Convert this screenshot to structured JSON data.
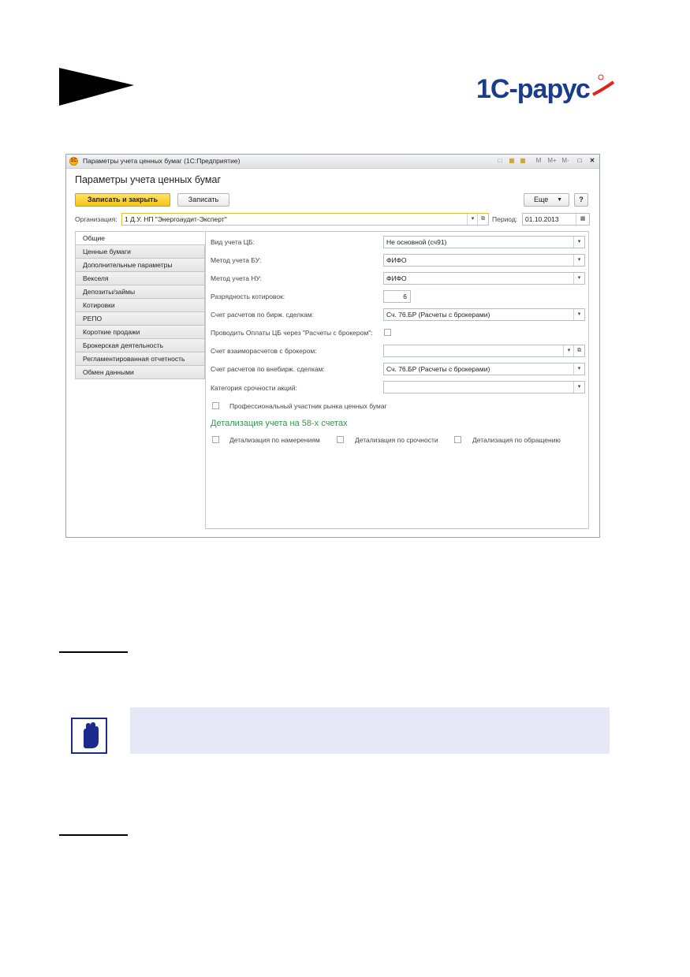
{
  "logo": {
    "text": "1С-рарус",
    "brand_color": "#1b3c8c",
    "accent_color": "#e2231a"
  },
  "window": {
    "title": "Параметры учета ценных бумаг  (1С:Предприятие)",
    "titlebar_buttons": [
      "М",
      "М+",
      "М-"
    ],
    "form_title": "Параметры учета ценных бумаг",
    "toolbar": {
      "save_close": "Записать и закрыть",
      "save": "Записать",
      "more": "Еще",
      "help": "?"
    },
    "org_label": "Организация:",
    "org_value": "1 Д.У. НП \"Энергоаудит-Эксперт\"",
    "period_label": "Период:",
    "period_value": "01.10.2013",
    "tabs": [
      "Общие",
      "Ценные бумаги",
      "Дополнительные параметры",
      "Векселя",
      "Депозиты/займы",
      "Котировки",
      "РЕПО",
      "Короткие продажи",
      "Брокерская деятельность",
      "Регламентированная отчетность",
      "Обмен данными"
    ],
    "fields": {
      "vid_ucheta_label": "Вид учета ЦБ:",
      "vid_ucheta_value": "Не основной (сч91)",
      "metod_bu_label": "Метод учета БУ:",
      "metod_bu_value": "ФИФО",
      "metod_nu_label": "Метод учета НУ:",
      "metod_nu_value": "ФИФО",
      "razr_label": "Разрядность котировок:",
      "razr_value": "6",
      "schet_birzh_label": "Счет расчетов по бирж. сделкам:",
      "schet_birzh_value": "Сч. 76.БР (Расчеты с брокерами)",
      "provodit_label": "Проводить Оплаты ЦБ через \"Расчеты с брокером\":",
      "schet_vzaimo_label": "Счет взаиморасчетов с брокером:",
      "schet_vzaimo_value": "",
      "schet_vnebirzh_label": "Счет расчетов по внебирж. сделкам:",
      "schet_vnebirzh_value": "Сч. 76.БР (Расчеты с брокерами)",
      "kategoria_label": "Категория срочности акций:",
      "kategoria_value": "",
      "prof_label": "Профессиональный участник рынка ценных бумаг"
    },
    "detalization": {
      "heading": "Детализация учета на 58-х счетах",
      "namereniya": "Детализация по намерениям",
      "srochnost": "Детализация по срочности",
      "obrashchenie": "Детализация по обращению"
    }
  }
}
